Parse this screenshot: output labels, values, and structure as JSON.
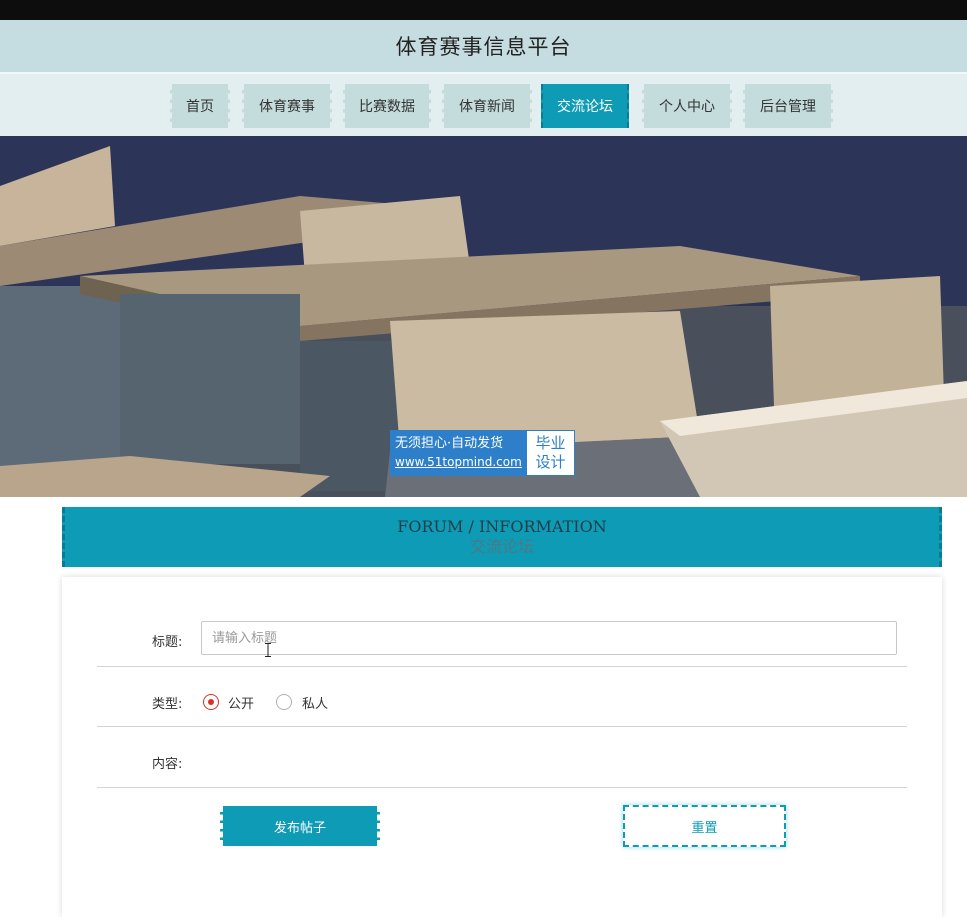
{
  "app": {
    "title": "体育赛事信息平台"
  },
  "nav": {
    "items": [
      {
        "label": "首页"
      },
      {
        "label": "体育赛事"
      },
      {
        "label": "比赛数据"
      },
      {
        "label": "体育新闻"
      },
      {
        "label": "交流论坛",
        "active": true
      },
      {
        "label": "个人中心"
      },
      {
        "label": "后台管理"
      }
    ]
  },
  "banner": {
    "watermark_line1": "无须担心·自动发货",
    "watermark_line2": "www.51topmind.com",
    "watermark_right1": "毕业",
    "watermark_right2": "设计"
  },
  "section": {
    "title_en": "FORUM / INFORMATION",
    "title_zh": "交流论坛"
  },
  "form": {
    "title_label": "标题:",
    "title_placeholder": "请输入标题",
    "title_value": "",
    "type_label": "类型:",
    "type_options": [
      {
        "label": "公开",
        "selected": true
      },
      {
        "label": "私人",
        "selected": false
      }
    ],
    "content_label": "内容:",
    "submit_label": "发布帖子",
    "reset_label": "重置"
  },
  "colors": {
    "accent": "#0e9bb5",
    "nav_bg": "#c4dcdc",
    "titlebar_bg": "#c5dce0",
    "radio_on": "#d93025"
  }
}
